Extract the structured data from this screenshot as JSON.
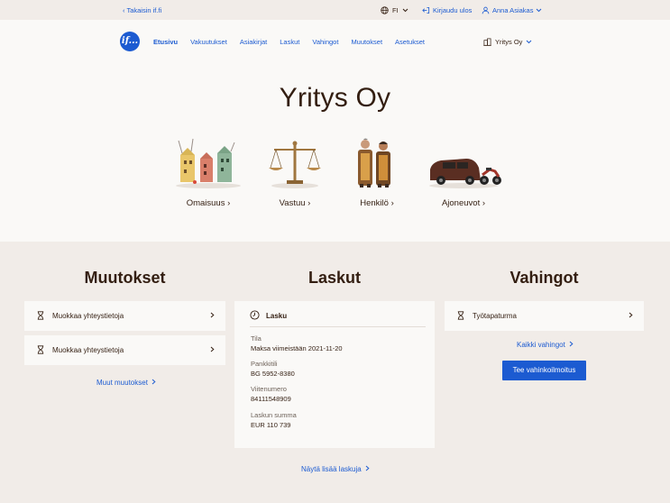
{
  "utility": {
    "back_label": "Takaisin if.fi",
    "language": "FI",
    "logout_label": "Kirjaudu ulos",
    "user_name": "Anna Asiakas"
  },
  "header": {
    "logo_text": "if...",
    "nav": [
      "Etusivu",
      "Vakuutukset",
      "Asiakirjat",
      "Laskut",
      "Vahingot",
      "Muutokset",
      "Asetukset"
    ],
    "company": "Yritys Oy"
  },
  "hero": {
    "title": "Yritys Oy",
    "categories": [
      {
        "label": "Omaisuus",
        "icon": "buildings-illustration"
      },
      {
        "label": "Vastuu",
        "icon": "scales-illustration"
      },
      {
        "label": "Henkilö",
        "icon": "people-illustration"
      },
      {
        "label": "Ajoneuvot",
        "icon": "vehicles-illustration"
      }
    ]
  },
  "changes": {
    "title": "Muutokset",
    "items": [
      {
        "label": "Muokkaa yhteystietoja"
      },
      {
        "label": "Muokkaa yhteystietoja"
      }
    ],
    "more_link": "Muut muutokset"
  },
  "invoices": {
    "title": "Laskut",
    "card_title": "Lasku",
    "fields": [
      {
        "key": "Tila",
        "value": "Maksa viimeistään 2021-11-20"
      },
      {
        "key": "Pankkitili",
        "value": "BG 5952-8380"
      },
      {
        "key": "Viitenumero",
        "value": "84111548909"
      },
      {
        "key": "Laskun summa",
        "value": "EUR 110 739"
      }
    ],
    "more_link": "Näytä lisää laskuja"
  },
  "claims": {
    "title": "Vahingot",
    "items": [
      {
        "label": "Työtapaturma"
      }
    ],
    "all_link": "Kaikki vahingot",
    "report_button": "Tee vahinkoilmoitus"
  },
  "colors": {
    "accent": "#1c5bd1",
    "text": "#331e11",
    "background": "#f1ece8",
    "card": "#faf9f7"
  }
}
